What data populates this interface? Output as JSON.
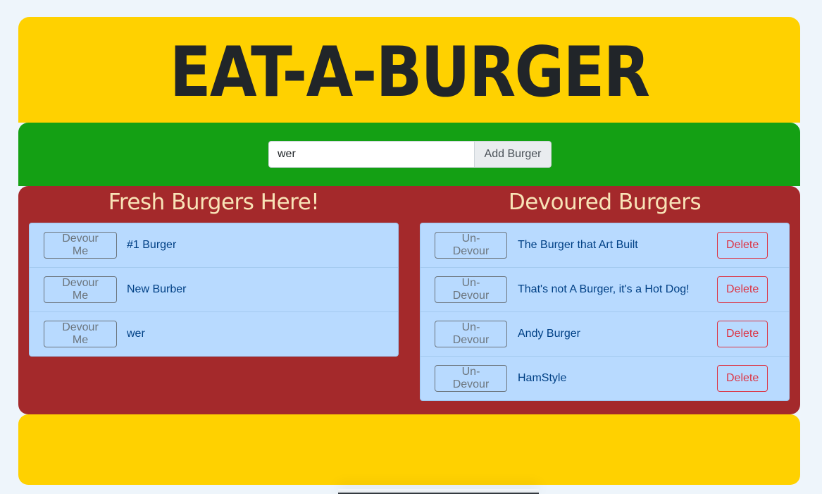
{
  "header": {
    "title": "EAT-A-BURGER"
  },
  "form": {
    "input_value": "wer",
    "add_button_label": "Add Burger"
  },
  "fresh": {
    "heading": "Fresh Burgers Here!",
    "button_label": "Devour Me",
    "items": [
      {
        "name": "#1 Burger"
      },
      {
        "name": "New Burber"
      },
      {
        "name": "wer"
      }
    ]
  },
  "devoured": {
    "heading": "Devoured Burgers",
    "undevour_label": "Un-Devour",
    "delete_label": "Delete",
    "items": [
      {
        "name": "The Burger that Art Built"
      },
      {
        "name": "That's not A Burger, it's a Hot Dog!"
      },
      {
        "name": "Andy Burger"
      },
      {
        "name": "HamStyle"
      }
    ]
  },
  "colors": {
    "bun": "#ffd100",
    "lettuce": "#14a014",
    "patty": "#a4292b",
    "list_bg": "#b8daff",
    "heading_text": "#f8e3b7",
    "delete": "#dc3545"
  }
}
